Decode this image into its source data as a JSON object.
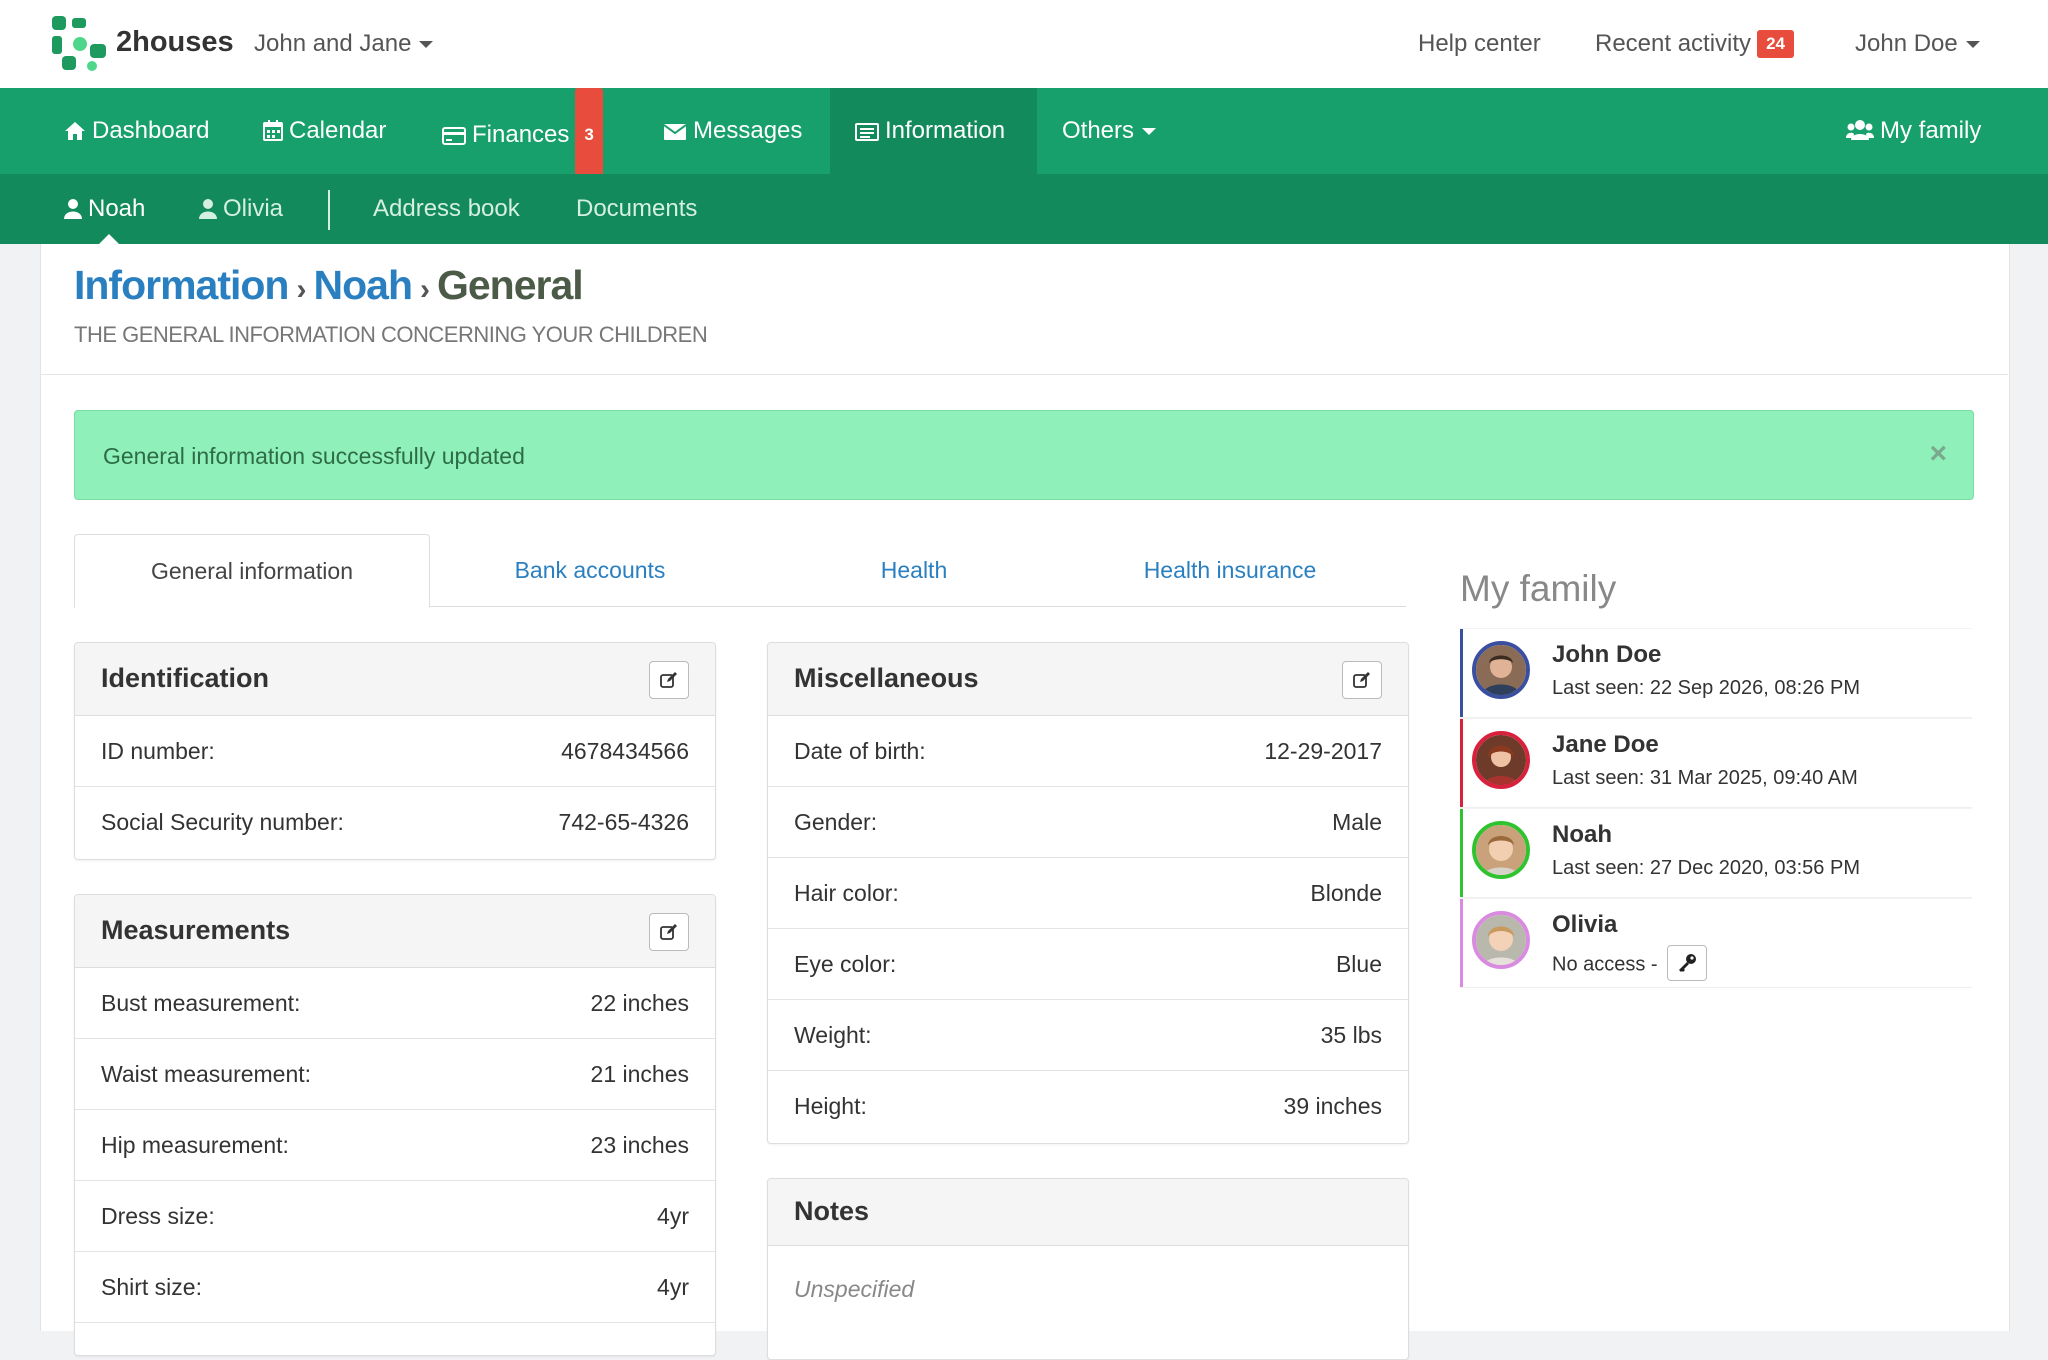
{
  "header": {
    "brand": "2houses",
    "family_selector": "John and Jane",
    "help_center": "Help center",
    "recent_activity": "Recent activity",
    "recent_activity_count": "24",
    "user_menu": "John Doe"
  },
  "main_nav": {
    "items": [
      {
        "label": "Dashboard",
        "icon": "home-icon"
      },
      {
        "label": "Calendar",
        "icon": "calendar-icon"
      },
      {
        "label": "Finances",
        "icon": "credit-card-icon",
        "badge": "3"
      },
      {
        "label": "Messages",
        "icon": "envelope-icon"
      },
      {
        "label": "Information",
        "icon": "list-icon",
        "active": true
      },
      {
        "label": "Others",
        "icon": "chevron-down-icon"
      }
    ],
    "my_family": "My family"
  },
  "sub_nav": {
    "children": [
      "Noah",
      "Olivia"
    ],
    "links": [
      "Address book",
      "Documents"
    ]
  },
  "page": {
    "breadcrumb": [
      "Information",
      "Noah",
      "General"
    ],
    "subtitle": "THE GENERAL INFORMATION CONCERNING YOUR CHILDREN",
    "alert": "General information successfully updated",
    "alert_close": "×"
  },
  "tabs": [
    "General information",
    "Bank accounts",
    "Health",
    "Health insurance"
  ],
  "identification": {
    "title": "Identification",
    "rows": [
      {
        "label": "ID number:",
        "value": "4678434566"
      },
      {
        "label": "Social Security number:",
        "value": "742-65-4326"
      }
    ]
  },
  "measurements": {
    "title": "Measurements",
    "rows": [
      {
        "label": "Bust measurement:",
        "value": "22 inches"
      },
      {
        "label": "Waist measurement:",
        "value": "21 inches"
      },
      {
        "label": "Hip measurement:",
        "value": "23 inches"
      },
      {
        "label": "Dress size:",
        "value": "4yr"
      },
      {
        "label": "Shirt size:",
        "value": "4yr"
      }
    ]
  },
  "miscellaneous": {
    "title": "Miscellaneous",
    "rows": [
      {
        "label": "Date of birth:",
        "value": "12-29-2017"
      },
      {
        "label": "Gender:",
        "value": "Male"
      },
      {
        "label": "Hair color:",
        "value": "Blonde"
      },
      {
        "label": "Eye color:",
        "value": "Blue"
      },
      {
        "label": "Weight:",
        "value": "35 lbs"
      },
      {
        "label": "Height:",
        "value": "39 inches"
      }
    ]
  },
  "notes": {
    "title": "Notes",
    "value": "Unspecified"
  },
  "family": {
    "title": "My family",
    "members": [
      {
        "name": "John Doe",
        "status": "Last seen: 22 Sep 2026, 08:26 PM",
        "color": "#3b4fa0"
      },
      {
        "name": "Jane Doe",
        "status": "Last seen: 31 Mar 2025, 09:40 AM",
        "color": "#d9213d"
      },
      {
        "name": "Noah",
        "status": "Last seen: 27 Dec 2020, 03:56 PM",
        "color": "#2fc42f"
      },
      {
        "name": "Olivia",
        "status": "No access -",
        "color": "#d98be0"
      }
    ]
  },
  "colors": {
    "brand_green": "#18a06c",
    "subnav_green": "#128a5b",
    "link_blue": "#2a7fc1",
    "alert_bg": "#8ff0ba",
    "badge_red": "#e74c3c"
  }
}
